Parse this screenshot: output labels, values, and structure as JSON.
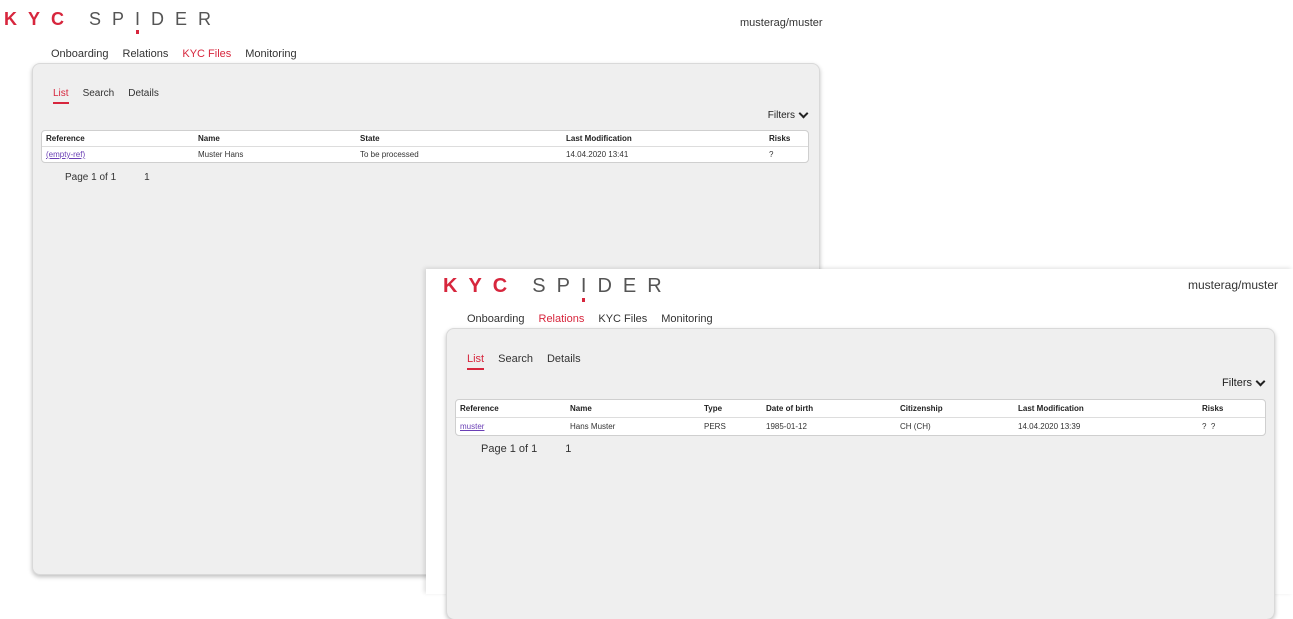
{
  "kyc_files_window": {
    "logo": {
      "kyc": "KYC",
      "spider_pre": "SP",
      "spider_i": "I",
      "spider_post": "DER"
    },
    "user": "musterag/muster",
    "nav": [
      "Onboarding",
      "Relations",
      "KYC Files",
      "Monitoring"
    ],
    "nav_active": "KYC Files",
    "subtabs": [
      "List",
      "Search",
      "Details"
    ],
    "filters_label": "Filters",
    "table": {
      "headers": [
        "Reference",
        "Name",
        "State",
        "Last Modification",
        "Risks"
      ],
      "rows": [
        [
          "(empty-ref)",
          "Muster Hans",
          "To be processed",
          "14.04.2020 13:41",
          "?"
        ]
      ]
    },
    "pager": {
      "text": "Page 1 of 1",
      "page": "1"
    }
  },
  "relations_window": {
    "logo": {
      "kyc": "KYC",
      "spider_pre": "SP",
      "spider_i": "I",
      "spider_post": "DER"
    },
    "user": "musterag/muster",
    "nav": [
      "Onboarding",
      "Relations",
      "KYC Files",
      "Monitoring"
    ],
    "nav_active": "Relations",
    "subtabs": [
      "List",
      "Search",
      "Details"
    ],
    "filters_label": "Filters",
    "table": {
      "headers": [
        "Reference",
        "Name",
        "Type",
        "Date of birth",
        "Citizenship",
        "Last Modification",
        "Risks"
      ],
      "rows": [
        [
          "muster",
          "Hans Muster",
          "PERS",
          "1985-01-12",
          "CH (CH)",
          "14.04.2020 13:39",
          "?  ?"
        ]
      ]
    },
    "pager": {
      "text": "Page 1 of 1",
      "page": "1"
    }
  },
  "colors": {
    "brand_red": "#d7263d",
    "link": "#6a3fb5",
    "panel_bg": "#efefef"
  },
  "icons": {
    "filters": "chevron-down-icon"
  }
}
